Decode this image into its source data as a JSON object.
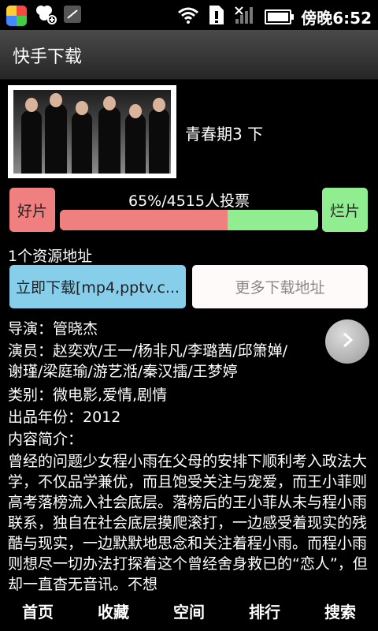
{
  "status_bar": {
    "time": "傍晚6:52"
  },
  "header": {
    "title": "快手下载"
  },
  "movie": {
    "name": "青春期3 下"
  },
  "vote": {
    "good_label": "好片",
    "bad_label": "烂片",
    "summary": "65%/4515人投票",
    "good_fraction": 0.65
  },
  "resources": {
    "count_text": "1个资源地址",
    "download_label": "立即下载[mp4,pptv.c...",
    "more_label": "更多下载地址"
  },
  "info": {
    "director": "导演：管晓杰",
    "actors_line1": "演员：赵奕欢/王一/杨非凡/李璐茜/邱箫婵/",
    "actors_line2": "谢瑾/梁庭瑜/游艺湉/秦汉擂/王梦婷",
    "category": "类别：微电影,爱情,剧情",
    "year": "出品年份：2012",
    "synopsis_label": "内容简介：",
    "synopsis": "曾经的问题少女程小雨在父母的安排下顺利考入政法大学，不仅品学兼优，而且饱受关注与宠爱，而王小菲则高考落榜流入社会底层。落榜后的王小菲从未与程小雨联系，独自在社会底层摸爬滚打，一边感受着现实的残酷与现实，一边默默地思念和关注着程小雨。而程小雨则想尽一切办法打探着这个曾经舍身救已的“恋人”，但却一直杳无音讯。不想"
  },
  "bottom_nav": [
    {
      "label": "首页"
    },
    {
      "label": "收藏"
    },
    {
      "label": "空间"
    },
    {
      "label": "排行"
    },
    {
      "label": "搜索"
    }
  ],
  "colors": {
    "good": "#f08080",
    "bad": "#90ee90",
    "download_button": "#87ceeb"
  },
  "icons": [
    "app-icon",
    "clover-icon",
    "dialer-icon",
    "wifi-icon",
    "sim-alert-icon",
    "signal-icon",
    "battery-icon",
    "next-arrow-icon"
  ]
}
